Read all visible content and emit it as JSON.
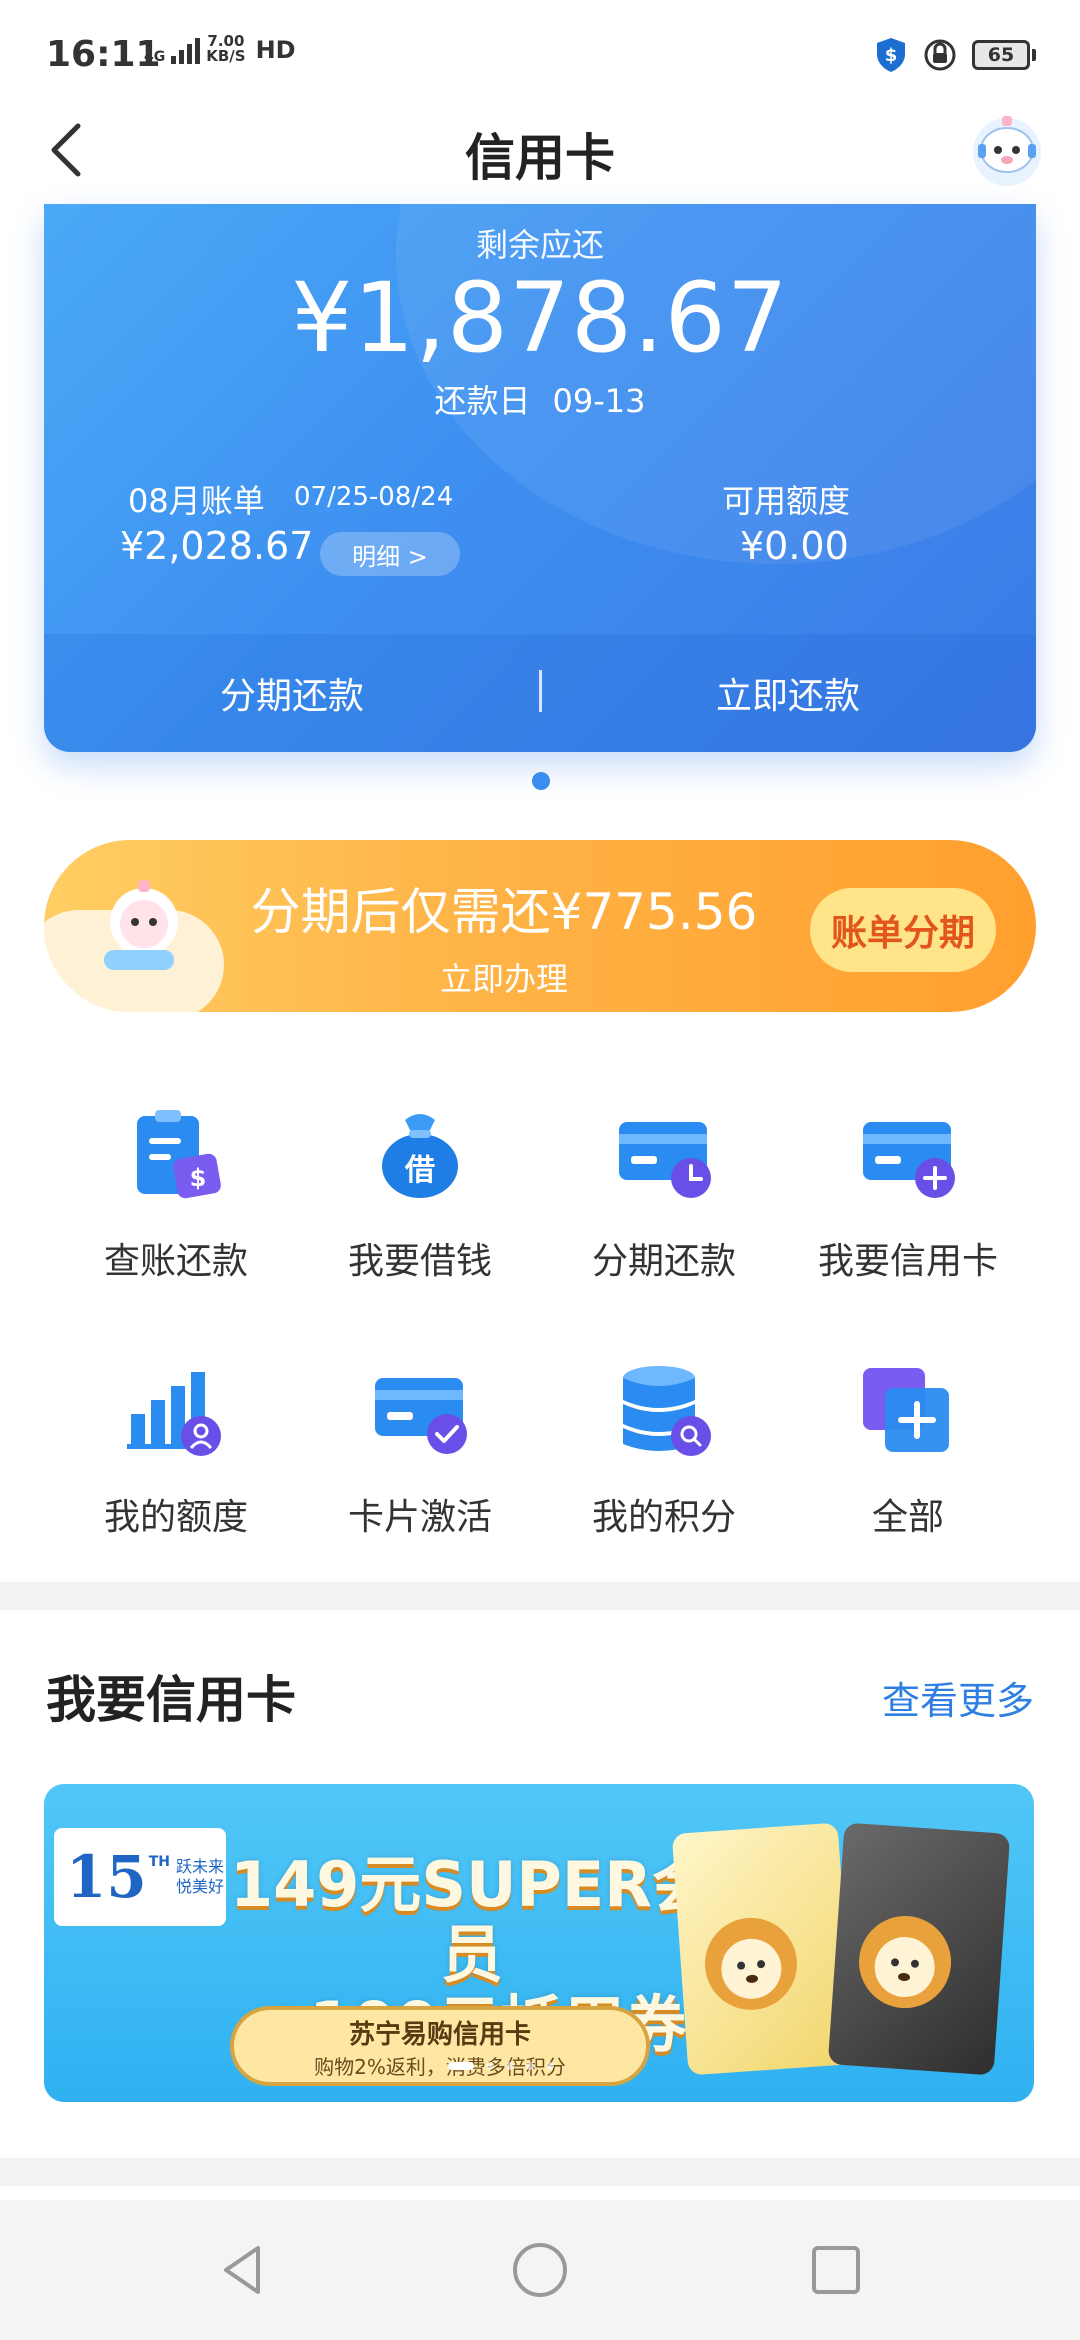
{
  "status_bar": {
    "time": "16:11",
    "network_small": "4G",
    "speed_value": "7.00",
    "speed_unit": "KB/S",
    "hd": "HD",
    "battery": "65",
    "icons": [
      "shield-dollar-icon",
      "lock-rotation-icon",
      "battery-icon"
    ]
  },
  "nav": {
    "title": "信用卡",
    "back_icon": "chevron-left-icon",
    "avatar_icon": "robot-mascot-avatar"
  },
  "card": {
    "remaining_label": "剩余应还",
    "remaining_amount": "¥1,878.67",
    "due_label": "还款日",
    "due_date": "09-13",
    "bill_title": "08月账单",
    "bill_period": "07/25-08/24",
    "bill_amount": "¥2,028.67",
    "detail_button": "明细 >",
    "credit_title": "可用额度",
    "credit_amount": "¥0.00",
    "installment_button": "分期还款",
    "repay_button": "立即还款"
  },
  "promo": {
    "main_text": "分期后仅需还¥775.56",
    "sub_text": "立即办理",
    "button": "账单分期"
  },
  "grid": [
    {
      "label": "查账还款",
      "icon": "bill-dollar-icon"
    },
    {
      "label": "我要借钱",
      "icon": "money-bag-icon"
    },
    {
      "label": "分期还款",
      "icon": "card-clock-icon"
    },
    {
      "label": "我要信用卡",
      "icon": "card-plus-icon"
    },
    {
      "label": "我的额度",
      "icon": "bar-chart-user-icon"
    },
    {
      "label": "卡片激活",
      "icon": "card-check-icon"
    },
    {
      "label": "我的积分",
      "icon": "database-search-icon"
    },
    {
      "label": "全部",
      "icon": "squares-plus-icon"
    }
  ],
  "grid_bag_char": "借",
  "recommend": {
    "title": "我要信用卡",
    "more": "查看更多",
    "banner": {
      "anniversary_num": "15",
      "anniversary_th": "TH",
      "slogan_line1": "跃未来",
      "slogan_line2": "悦美好",
      "headline_line1": "149元SUPER会员",
      "headline_line2": "+100元抵用券",
      "pill_title": "苏宁易购信用卡",
      "pill_sub": "购物2%返利，消费多倍积分"
    }
  },
  "system_nav": {
    "buttons": [
      "triangle-back-icon",
      "circle-home-icon",
      "square-recents-icon"
    ]
  },
  "colors": {
    "card_blue": "#3d8ff0",
    "accent_blue": "#2f7fe3",
    "promo_orange": "#ff9f2e",
    "promo_button_text": "#e2561d"
  }
}
